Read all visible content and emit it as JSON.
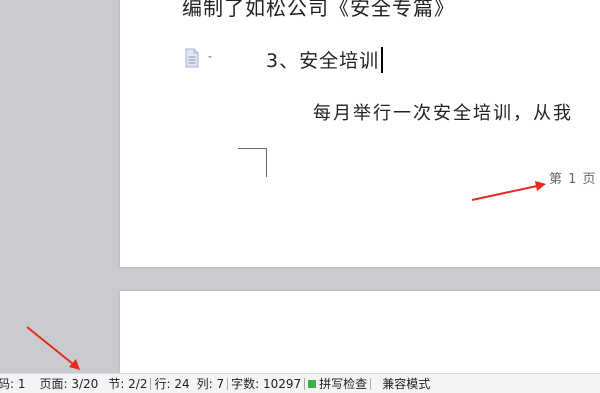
{
  "document": {
    "line_top": "编制了如松公司《安全专篇》",
    "heading": "3、安全培训",
    "paragraph": "每月举行一次安全培训，从我",
    "page_footer": "第 1 页"
  },
  "statusbar": {
    "page_num": "码: 1",
    "page": "页面: 3/20",
    "section": "节: 2/2",
    "row": "行: 24",
    "column": "列: 7",
    "word_count": "字数: 10297",
    "spell_check": "拼写检查",
    "compat_mode": "兼容模式"
  },
  "colors": {
    "arrow": "#e8281e",
    "spell_indicator": "#3bb34a"
  }
}
